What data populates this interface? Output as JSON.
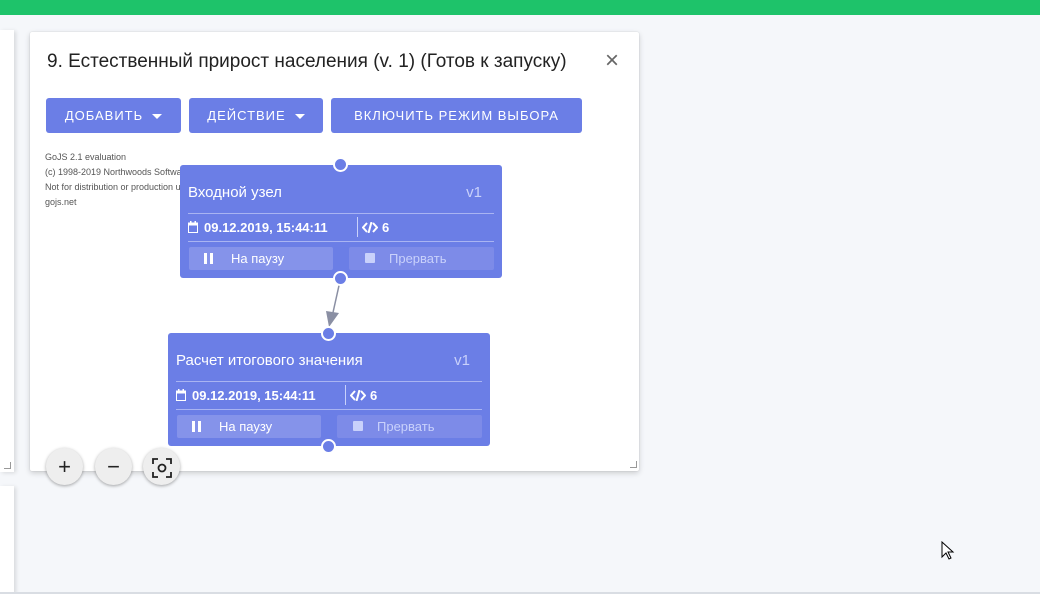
{
  "window": {
    "title": "9. Естественный прирост населения (v. 1) (Готов к запуску)",
    "close_icon": "close-icon"
  },
  "toolbar": {
    "add_label": "ДОБАВИТЬ",
    "action_label": "ДЕЙСТВИЕ",
    "select_mode_label": "ВКЛЮЧИТЬ РЕЖИМ ВЫБОРА"
  },
  "watermark": {
    "line1": "GoJS 2.1 evaluation",
    "line2": "(c) 1998-2019 Northwoods Software",
    "line3": "Not for distribution or production use",
    "line4": "gojs.net"
  },
  "nodes": [
    {
      "title": "Входной узел",
      "version": "v1",
      "date": "09.12.2019, 15:44:11",
      "code_count": "6",
      "pause_label": "На паузу",
      "abort_label": "Прервать"
    },
    {
      "title": "Расчет итогового значения",
      "version": "v1",
      "date": "09.12.2019, 15:44:11",
      "code_count": "6",
      "pause_label": "На паузу",
      "abort_label": "Прервать"
    }
  ],
  "zoom": {
    "in_label": "+",
    "out_label": "−"
  },
  "colors": {
    "topbar": "#1ec36a",
    "accent": "#6b7ee6"
  }
}
